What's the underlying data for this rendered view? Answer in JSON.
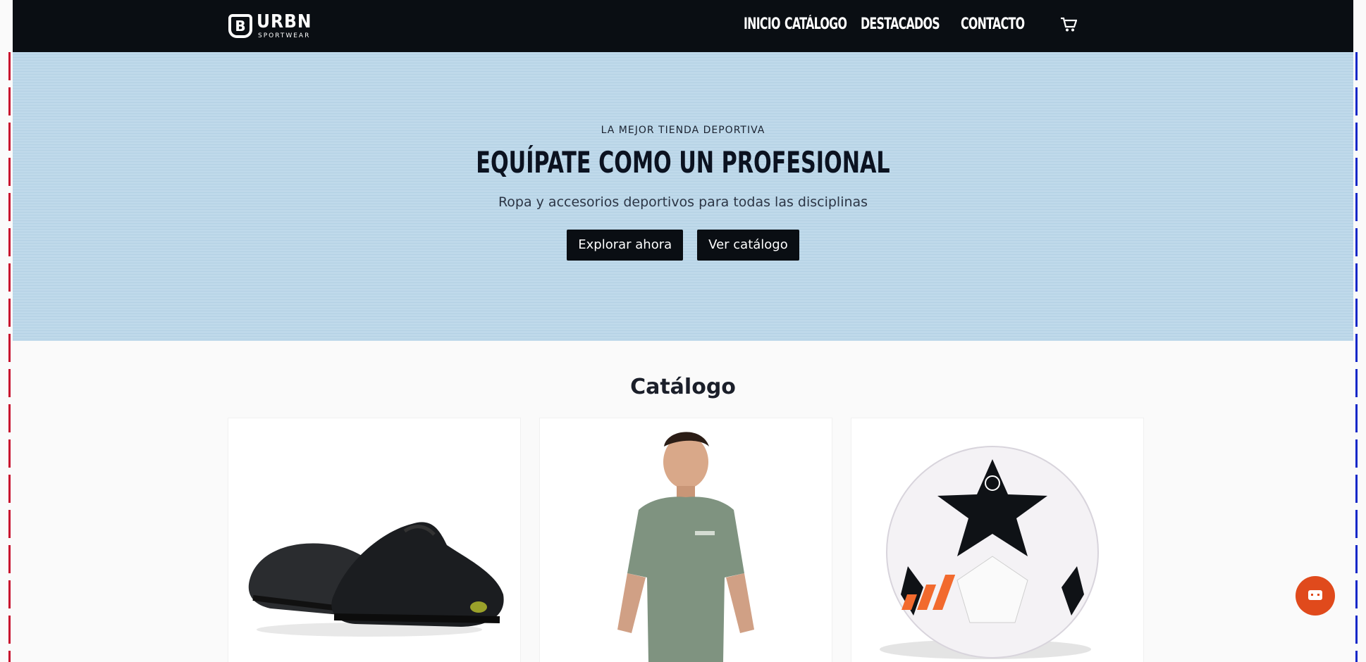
{
  "brand": {
    "name": "URBN",
    "tagline": "SPORTWEAR"
  },
  "nav": {
    "links": [
      "INICIO",
      "CATÁLOGO",
      "DESTACADOS",
      "CONTACTO"
    ],
    "cart_icon": "cart-icon"
  },
  "hero": {
    "eyebrow": "LA MEJOR TIENDA DEPORTIVA",
    "title": "EQUÍPATE COMO UN PROFESIONAL",
    "subtitle": "Ropa y accesorios deportivos para todas las disciplinas",
    "primary_button": "Explorar ahora",
    "secondary_button": "Ver catálogo"
  },
  "catalog": {
    "title": "Catálogo",
    "products": [
      {
        "image": "black-running-shoes"
      },
      {
        "image": "man-in-green-tshirt"
      },
      {
        "image": "champions-league-ball"
      }
    ]
  },
  "chat": {
    "icon": "chat-icon"
  },
  "colors": {
    "nav_bg": "#0a0e13",
    "hero_bg": "#bfd9ea",
    "accent": "#e04a1c"
  }
}
